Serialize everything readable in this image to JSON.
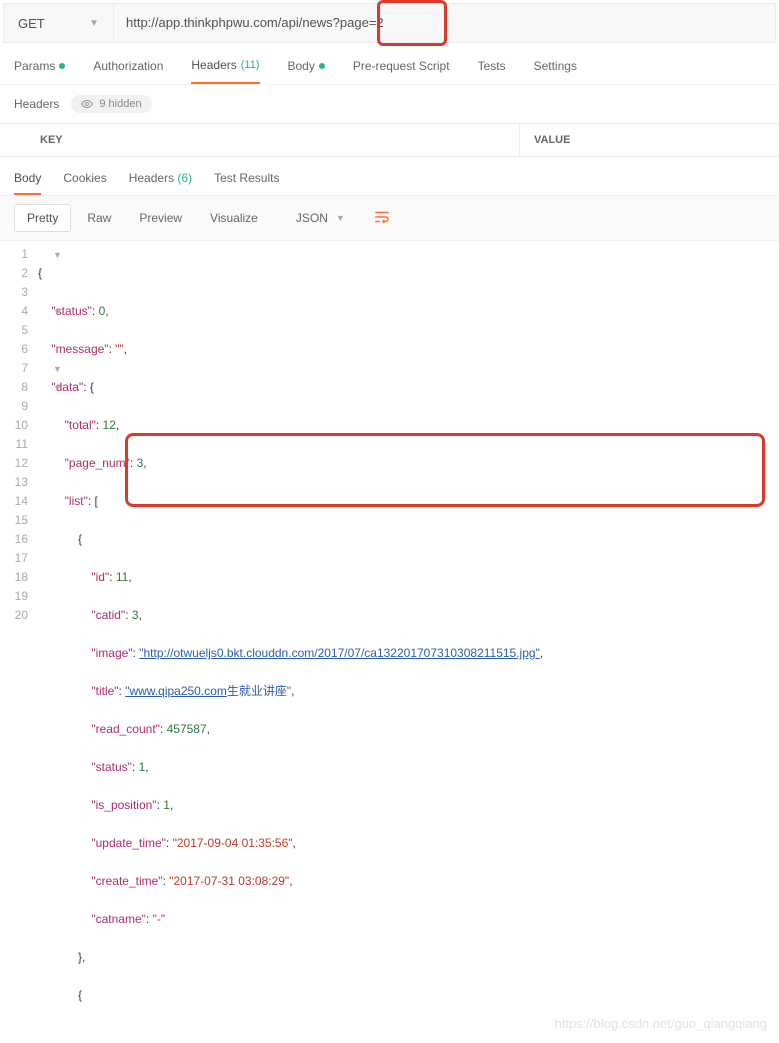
{
  "request": {
    "method": "GET",
    "url": "http://app.thinkphpwu.com/api/news?page=2"
  },
  "tabs": {
    "params": "Params",
    "authorization": "Authorization",
    "headers": "Headers",
    "headers_count": "(11)",
    "body": "Body",
    "prerequest": "Pre-request Script",
    "tests": "Tests",
    "settings": "Settings"
  },
  "headers_sub": {
    "label": "Headers",
    "hidden": "9 hidden"
  },
  "kv": {
    "key": "KEY",
    "value": "VALUE"
  },
  "resp_tabs": {
    "body": "Body",
    "cookies": "Cookies",
    "headers": "Headers",
    "headers_count": "(6)",
    "test_results": "Test Results"
  },
  "toolbar": {
    "pretty": "Pretty",
    "raw": "Raw",
    "preview": "Preview",
    "visualize": "Visualize",
    "json": "JSON"
  },
  "code": {
    "l1": "{",
    "l2_k": "\"status\"",
    "l2_v": "0",
    "l3_k": "\"message\"",
    "l3_v": "\"\"",
    "l4_k": "\"data\"",
    "l5_k": "\"total\"",
    "l5_v": "12",
    "l6_k": "\"page_num\"",
    "l6_v": "3",
    "l7_k": "\"list\"",
    "l8": "{",
    "l9_k": "\"id\"",
    "l9_v": "11",
    "l10_k": "\"catid\"",
    "l10_v": "3",
    "l11_k": "\"image\"",
    "l11_v": "\"http://otwueljs0.bkt.clouddn.com/2017/07/ca132201707310308211515.jpg\"",
    "l12_k": "\"title\"",
    "l12_v1": "\"www.qipa250.com",
    "l12_v2": "生就业讲座\"",
    "l13_k": "\"read_count\"",
    "l13_v": "457587",
    "l14_k": "\"status\"",
    "l14_v": "1",
    "l15_k": "\"is_position\"",
    "l15_v": "1",
    "l16_k": "\"update_time\"",
    "l16_v": "\"2017-09-04 01:35:56\"",
    "l17_k": "\"create_time\"",
    "l17_v": "\"2017-07-31 03:08:29\"",
    "l18_k": "\"catname\"",
    "l18_v": "\"-\"",
    "l19": "},",
    "l20": "{"
  },
  "watermark": "https://blog.csdn.net/guo_qiangqiang"
}
